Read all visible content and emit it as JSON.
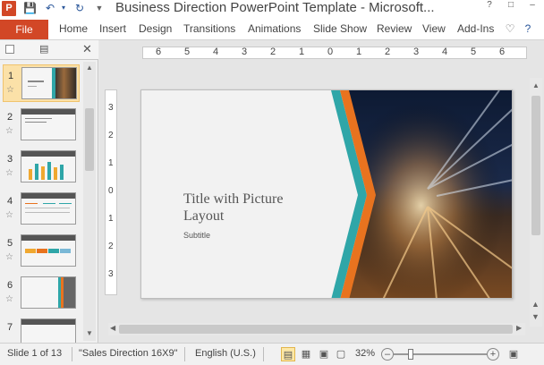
{
  "window": {
    "title": "Business Direction PowerPoint Template  -  Microsoft...",
    "app_icon": "P"
  },
  "ribbon": {
    "file_label": "File",
    "tabs": [
      "Home",
      "Insert",
      "Design",
      "Transitions",
      "Animations",
      "Slide Show",
      "Review",
      "View",
      "Add-Ins"
    ]
  },
  "thumbnails": [
    {
      "num": "1"
    },
    {
      "num": "2"
    },
    {
      "num": "3"
    },
    {
      "num": "4"
    },
    {
      "num": "5"
    },
    {
      "num": "6"
    },
    {
      "num": "7"
    }
  ],
  "hruler_ticks": [
    "6",
    "5",
    "4",
    "3",
    "2",
    "1",
    "0",
    "1",
    "2",
    "3",
    "4",
    "5",
    "6"
  ],
  "vruler_ticks": [
    "3",
    "2",
    "1",
    "0",
    "1",
    "2",
    "3"
  ],
  "slide": {
    "title": "Title with Picture Layout",
    "subtitle": "Subtitle"
  },
  "status": {
    "slide_info": "Slide 1 of 13",
    "theme": "\"Sales Direction 16X9\"",
    "language": "English (U.S.)",
    "zoom": "32%",
    "zoom_level_percent": 32
  },
  "colors": {
    "file_tab": "#d24726",
    "accent_orange": "#e8731f",
    "accent_teal": "#2fa6a8",
    "selection": "#fbe1a8"
  }
}
